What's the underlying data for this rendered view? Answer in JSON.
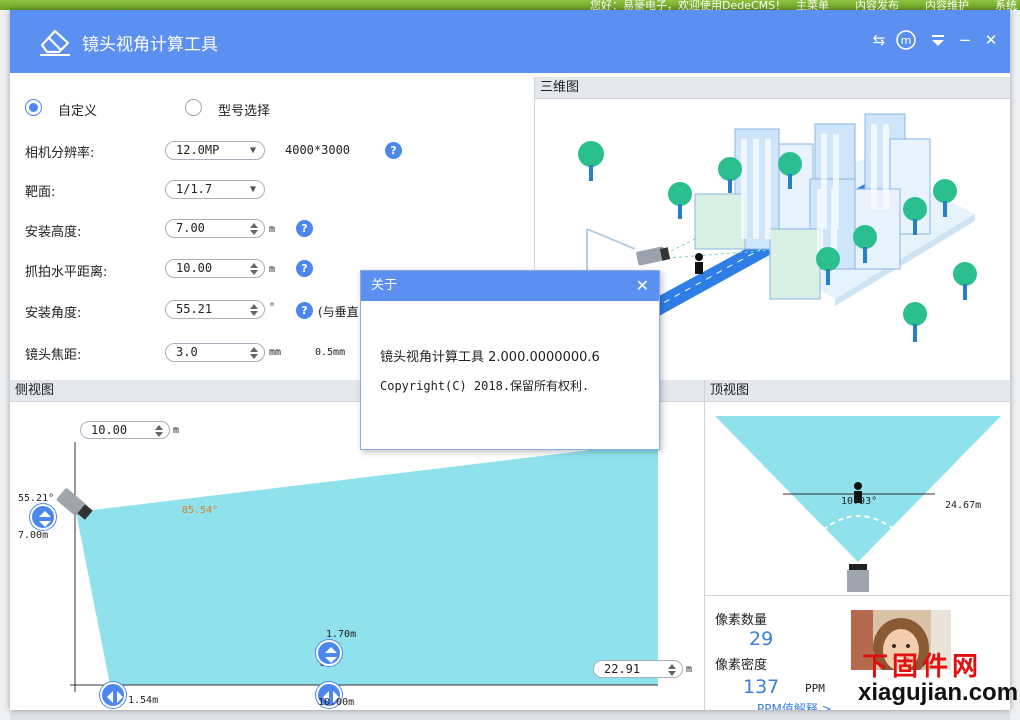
{
  "background_page": {
    "topbar_text": "您好：易豪电子，欢迎使用DedeCMS！",
    "topbar_menu": [
      "主菜单",
      "内容发布",
      "内容维护",
      "系统"
    ]
  },
  "app": {
    "title": "镜头视角计算工具"
  },
  "form": {
    "radio_custom": "自定义",
    "radio_model": "型号选择",
    "resolution_label": "相机分辨率:",
    "resolution_value": "12.0MP",
    "resolution_pixels": "4000*3000",
    "target_label": "靶面:",
    "target_value": "1/1.7",
    "height_label": "安装高度:",
    "height_value": "7.00",
    "height_unit": "m",
    "distance_label": "抓拍水平距离:",
    "distance_value": "10.00",
    "distance_unit": "m",
    "angle_label": "安装角度:",
    "angle_value": "55.21",
    "angle_unit": "°",
    "angle_note": "(与垂直",
    "focal_label": "镜头焦距:",
    "focal_value": "3.0",
    "focal_unit": "mm",
    "focal_step": "0.5mm"
  },
  "panels": {
    "three_d": "三维图",
    "side": "侧视图",
    "top": "顶视图"
  },
  "side_view": {
    "top_input": "10.00",
    "top_unit": "m",
    "angle_label": "55.21°",
    "height_label": "7.00m",
    "fov_angle": "85.54°",
    "person_height": "1.70m",
    "near_label": "1.54m",
    "person_dist": "10.00m",
    "far_input": "22.91",
    "far_unit": "m"
  },
  "top_view": {
    "angle_label": "10?93°",
    "width_label": "24.67m"
  },
  "pixels": {
    "count_label": "像素数量",
    "count_value": "29",
    "density_label": "像素密度",
    "density_value": "137",
    "density_unit": "PPM",
    "ppm_link": "PPM值解释 >"
  },
  "dialog": {
    "title": "关于",
    "line1": "镜头视角计算工具 2.000.0000000.6",
    "line2": "Copyright(C) 2018.保留所有权利."
  },
  "watermark": {
    "cn": "下固件网",
    "en": "xiagujian.com"
  },
  "colors": {
    "accent": "#5b8ff0",
    "fov_fill": "#8fe2ec",
    "button_blue": "#4c86ee",
    "angle_orange": "#d9822b"
  }
}
